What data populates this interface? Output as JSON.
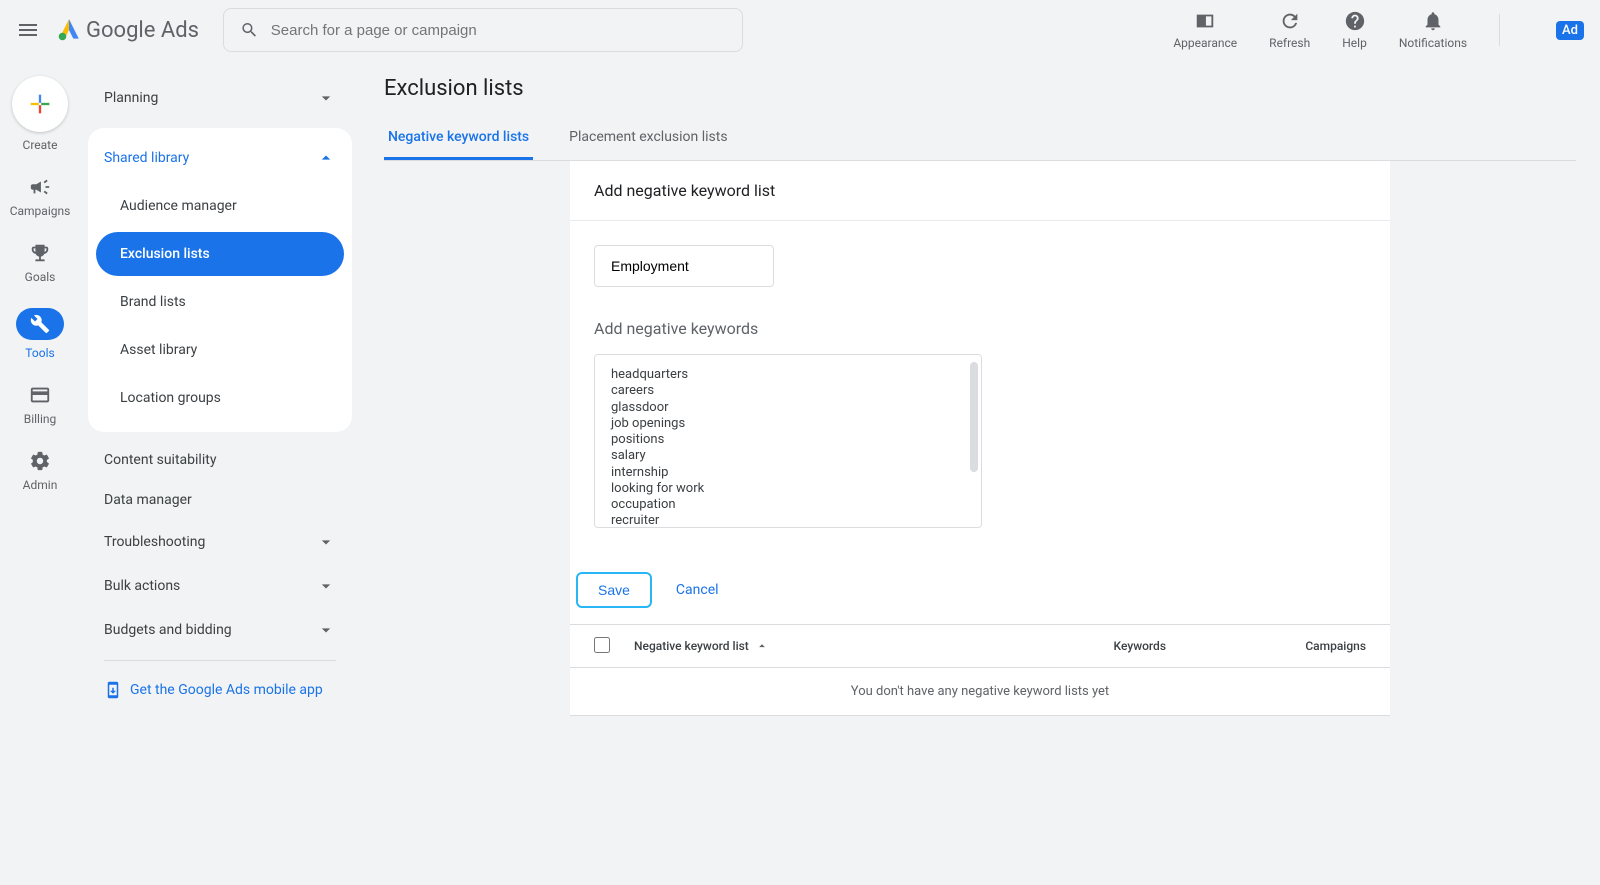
{
  "header": {
    "brand": "Google Ads",
    "search_placeholder": "Search for a page or campaign",
    "actions": {
      "appearance": "Appearance",
      "refresh": "Refresh",
      "help": "Help",
      "notifications": "Notifications"
    },
    "ad_badge": "Ad"
  },
  "rail": {
    "create": "Create",
    "campaigns": "Campaigns",
    "goals": "Goals",
    "tools": "Tools",
    "billing": "Billing",
    "admin": "Admin"
  },
  "sidebar": {
    "planning": "Planning",
    "shared_library": "Shared library",
    "items": {
      "audience_manager": "Audience manager",
      "exclusion_lists": "Exclusion lists",
      "brand_lists": "Brand lists",
      "asset_library": "Asset library",
      "location_groups": "Location groups"
    },
    "content_suitability": "Content suitability",
    "data_manager": "Data manager",
    "troubleshooting": "Troubleshooting",
    "bulk_actions": "Bulk actions",
    "budgets_bidding": "Budgets and bidding",
    "get_app": "Get the Google Ads mobile app"
  },
  "page": {
    "title": "Exclusion lists",
    "tabs": {
      "negative_keyword_lists": "Negative keyword lists",
      "placement_exclusion_lists": "Placement exclusion lists"
    }
  },
  "form": {
    "title": "Add negative keyword list",
    "list_name": "Employment",
    "section_label": "Add negative keywords",
    "keywords": "headquarters\ncareers\nglassdoor\njob openings\npositions\nsalary\ninternship\nlooking for work\noccupation\nrecruiter",
    "save": "Save",
    "cancel": "Cancel"
  },
  "table": {
    "col_name": "Negative keyword list",
    "col_keywords": "Keywords",
    "col_campaigns": "Campaigns",
    "empty": "You don't have any negative keyword lists yet"
  }
}
